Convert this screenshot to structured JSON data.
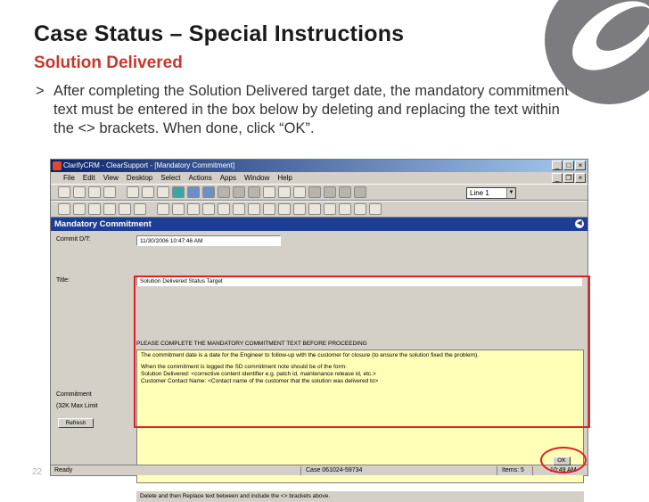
{
  "slide": {
    "title": "Case Status – Special Instructions",
    "subtitle": "Solution Delivered",
    "bullet_marker": ">",
    "bullet_text": "After completing the Solution Delivered target date, the mandatory commitment text must be entered in the box below by deleting and replacing the text within the <> brackets.  When done, click “OK”.",
    "page_number": "22"
  },
  "app": {
    "window_title": "ClarifyCRM - ClearSupport - [Mandatory Commitment]",
    "menu": [
      "File",
      "Edit",
      "View",
      "Desktop",
      "Select",
      "Actions",
      "Apps",
      "Window",
      "Help"
    ],
    "line_select_value": "Line 1",
    "panel_title": "Mandatory Commitment",
    "labels": {
      "commit_dt": "Commit D/T:",
      "title": "Title:",
      "commitment": "Commitment",
      "max_limit": "(32K Max Limit"
    },
    "commit_dt_value": "11/30/2006 10:47:46 AM",
    "title_value": "Solution Delivered Status Target",
    "warning": "PLEASE COMPLETE THE MANDATORY COMMITMENT TEXT BEFORE PROCEEDING",
    "commitment_text": [
      "The commitment date is a date for the Engineer to follow-up with the customer for closure (to ensure the solution fixed the problem).",
      "When the commitment is logged the SD commitment note should be of the form:\nSolution Delivered: <corrective content identifier e.g. patch id, maintenance release id, etc.>\nCustomer Contact Name: <Contact name of the customer that the solution was delivered to>"
    ],
    "commitment_footer": "Delete and then Replace text between and include the <> brackets above.",
    "refresh_label": "Refresh",
    "ok_label": "OK",
    "status": {
      "ready": "Ready",
      "case": "Case 061024-59734",
      "items": "Items: 5",
      "time": "10:49 AM"
    }
  },
  "colors": {
    "subtitle_red": "#c8372d",
    "highlight_red": "#e21f1f",
    "panel_blue": "#1c3f94",
    "commit_yellow": "#ffffb8"
  }
}
